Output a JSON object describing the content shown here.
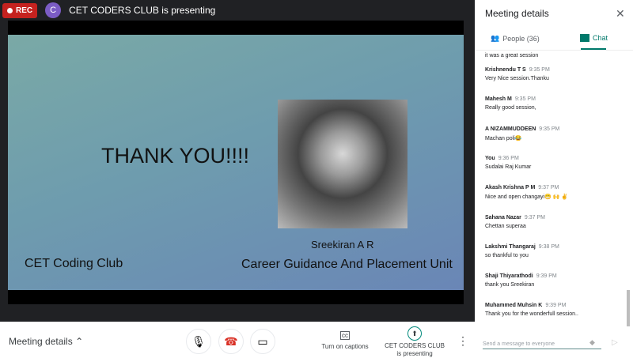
{
  "topbar": {
    "rec": "REC",
    "avatar": "C",
    "presenting": "CET CODERS CLUB is presenting"
  },
  "slide": {
    "title": "THANK YOU!!!!",
    "speaker": "Sreekiran A R",
    "club": "CET Coding Club",
    "unit": "Career Guidance And Placement Unit"
  },
  "bottom": {
    "meeting_details": "Meeting details",
    "captions": "Turn on captions",
    "presenter_line1": "CET CODERS CLUB",
    "presenter_line2": "is presenting"
  },
  "side": {
    "title": "Meeting details",
    "tab_people": "People (36)",
    "tab_chat": "Chat",
    "input_placeholder": "Send a message to everyone",
    "partial": "it was a great session",
    "messages": [
      {
        "name": "Krishnendu T S",
        "time": "9:35 PM",
        "text": "Very Nice session.Thanku"
      },
      {
        "name": "Mahesh M",
        "time": "9:35 PM",
        "text": "Really good session,"
      },
      {
        "name": "A NIZAMMUDDEEN",
        "time": "9:35 PM",
        "text": "Machan poli😂"
      },
      {
        "name": "You",
        "time": "9:36 PM",
        "text": "Sudalai Raj Kumar"
      },
      {
        "name": "Akash Krishna P M",
        "time": "9:37 PM",
        "text": "Nice and open changayi😁 🙌 ✌"
      },
      {
        "name": "Sahana Nazar",
        "time": "9:37 PM",
        "text": "Chettan superaa"
      },
      {
        "name": "Lakshmi Thangaraj",
        "time": "9:38 PM",
        "text": "so thankful to you"
      },
      {
        "name": "Shaji Thiyarathodi",
        "time": "9:39 PM",
        "text": "thank you Sreekiran"
      },
      {
        "name": "Muhammed Muhsin K",
        "time": "9:39 PM",
        "text": "Thank you for the wonderfull session.."
      }
    ]
  }
}
